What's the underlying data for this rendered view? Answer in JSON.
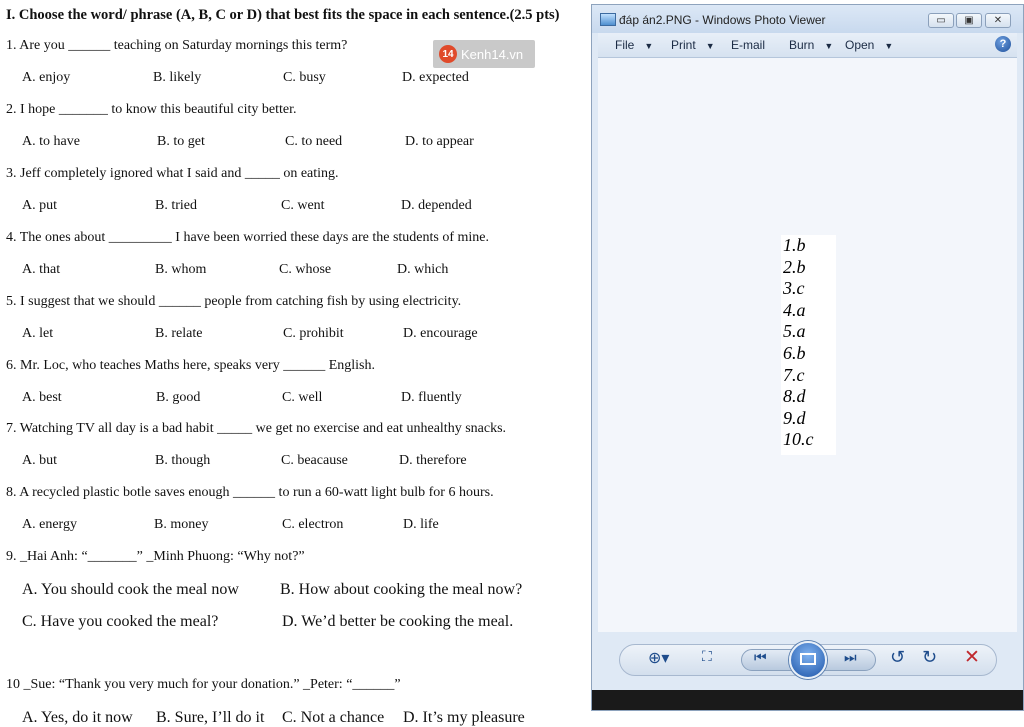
{
  "document": {
    "heading": "I. Choose the word/ phrase (A, B, C or D) that best fits the space in each sentence.(2.5 pts)",
    "watermark": "Kenh14.vn",
    "watermark_logo": "14",
    "questions": [
      {
        "text": "1. Are you ______ teaching on Saturday mornings this term?",
        "options": [
          "A. enjoy",
          "B. likely",
          "C. busy",
          "D. expected"
        ]
      },
      {
        "text": "2. I hope _______ to know this beautiful city better.",
        "options": [
          "A. to have",
          "B. to get",
          "C. to need",
          "D. to appear"
        ]
      },
      {
        "text": "3. Jeff completely ignored what I said and _____ on eating.",
        "options": [
          "A. put",
          "B. tried",
          "C. went",
          "D. depended"
        ]
      },
      {
        "text": "4. The ones about _________ I have been worried these days are the students of mine.",
        "options": [
          "A. that",
          "B. whom",
          "C. whose",
          "D. which"
        ]
      },
      {
        "text": "5. I suggest that we should ______ people from catching fish by using electricity.",
        "options": [
          "A. let",
          "B. relate",
          "C. prohibit",
          "D. encourage"
        ]
      },
      {
        "text": "6. Mr. Loc, who teaches Maths here, speaks very ______ English.",
        "options": [
          "A. best",
          "B. good",
          "C. well",
          "D. fluently"
        ]
      },
      {
        "text": "7. Watching TV all day is a bad habit _____ we get no exercise and eat unhealthy snacks.",
        "options": [
          "A. but",
          "B. though",
          "C. beacause",
          "D. therefore"
        ]
      },
      {
        "text": "8. A recycled plastic botle saves enough ______ to run a 60-watt light bulb for 6 hours.",
        "options": [
          "A. energy",
          "B. money",
          "C. electron",
          "D. life"
        ]
      },
      {
        "text": "9. _Hai Anh: “_______” _Minh Phuong: “Why not?”",
        "options": [
          "A. You should cook the meal now",
          "B. How about cooking the meal now?",
          "C. Have you cooked the meal?",
          "D. We’d better be cooking the meal."
        ]
      },
      {
        "text": "10 _Sue: “Thank you very much for your donation.”                _Peter: “______”",
        "options": [
          "A. Yes, do it now",
          "B. Sure, I’ll do it",
          "C. Not a chance",
          "D. It’s my pleasure"
        ]
      }
    ]
  },
  "viewer": {
    "title": "đáp án2.PNG - Windows Photo Viewer",
    "window_buttons": {
      "minimize": "▭",
      "maximize": "▣",
      "close": "✕"
    },
    "menu": [
      {
        "label": "File",
        "has_caret": true
      },
      {
        "label": "Print",
        "has_caret": true
      },
      {
        "label": "E-mail",
        "has_caret": false
      },
      {
        "label": "Burn",
        "has_caret": true
      },
      {
        "label": "Open",
        "has_caret": true
      }
    ],
    "help": "?",
    "answers": [
      "1.b",
      "2.b",
      "3.c",
      "4.a",
      "5.a",
      "6.b",
      "7.c",
      "8.d",
      "9.d",
      "10.c"
    ],
    "controls": {
      "zoom": "⊕▾",
      "actual_size": "⛶",
      "previous": "⏮",
      "next": "⏭",
      "rotate_ccw": "↺",
      "rotate_cw": "↻",
      "delete": "✕"
    },
    "colors": {
      "accent": "#1e55a8",
      "delete": "#c0282d"
    }
  }
}
